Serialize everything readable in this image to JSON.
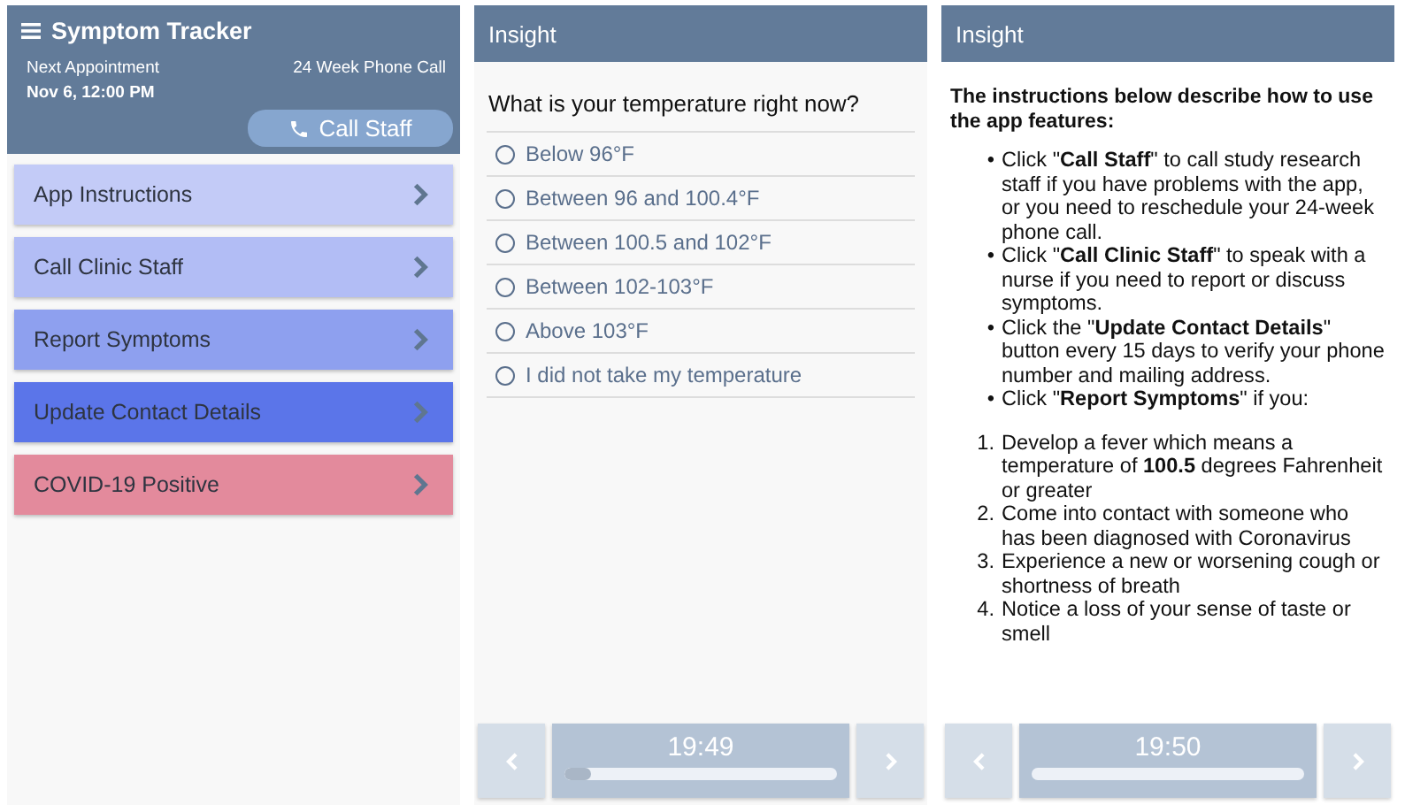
{
  "home": {
    "title": "Symptom Tracker",
    "appointment_label": "Next Appointment",
    "appointment_time": "Nov 6, 12:00 PM",
    "appointment_type": "24 Week Phone Call",
    "call_button": "Call Staff",
    "menu": [
      {
        "label": "App Instructions",
        "color": "#c3cbf7"
      },
      {
        "label": "Call Clinic Staff",
        "color": "#b2bdf5"
      },
      {
        "label": "Report Symptoms",
        "color": "#8ea0ef"
      },
      {
        "label": "Update Contact Details",
        "color": "#5b75e9"
      },
      {
        "label": "COVID-19 Positive",
        "color": "#e38a9c"
      }
    ]
  },
  "question_screen": {
    "title": "Insight",
    "question": "What is your temperature right now?",
    "options": [
      {
        "label": "Below 96°F",
        "selected": false
      },
      {
        "label": "Between 96 and 100.4°F",
        "selected": false
      },
      {
        "label": "Between 100.5 and 102°F",
        "selected": false
      },
      {
        "label": "Between 102-103°F",
        "selected": false
      },
      {
        "label": "Above 103°F",
        "selected": false
      },
      {
        "label": "I did not take my temperature",
        "selected": false
      }
    ],
    "footer": {
      "time": "19:49",
      "level": 0.1
    }
  },
  "instructions_screen": {
    "title": "Insight",
    "intro": "The instructions below describe how to use the app features:",
    "bullets": [
      {
        "marker": "•",
        "text": "Click \"**Call Staff**\" to call study research staff if you have problems with the app, or you need to reschedule your 24-week phone call."
      },
      {
        "marker": "•",
        "text": "Click \"**Call Clinic Staff**\" to speak with a nurse if you need to report or discuss symptoms."
      },
      {
        "marker": "•",
        "text": "Click the \"**Update Contact Details**\" button every 15 days to verify your phone number and mailing address."
      },
      {
        "marker": "•",
        "text": "Click \"**Report Symptoms**\" if you:"
      }
    ],
    "numbered": [
      {
        "marker": "1.",
        "text": "Develop a fever which means a temperature of **100.5** degrees Fahrenheit or greater"
      },
      {
        "marker": "2.",
        "text": "Come into contact with someone who has been diagnosed with Coronavirus"
      },
      {
        "marker": "3.",
        "text": "Experience a new or worsening cough or shortness of breath"
      },
      {
        "marker": "4.",
        "text": "Notice a loss of your sense of taste or smell"
      }
    ],
    "footer": {
      "time": "19:50"
    }
  }
}
